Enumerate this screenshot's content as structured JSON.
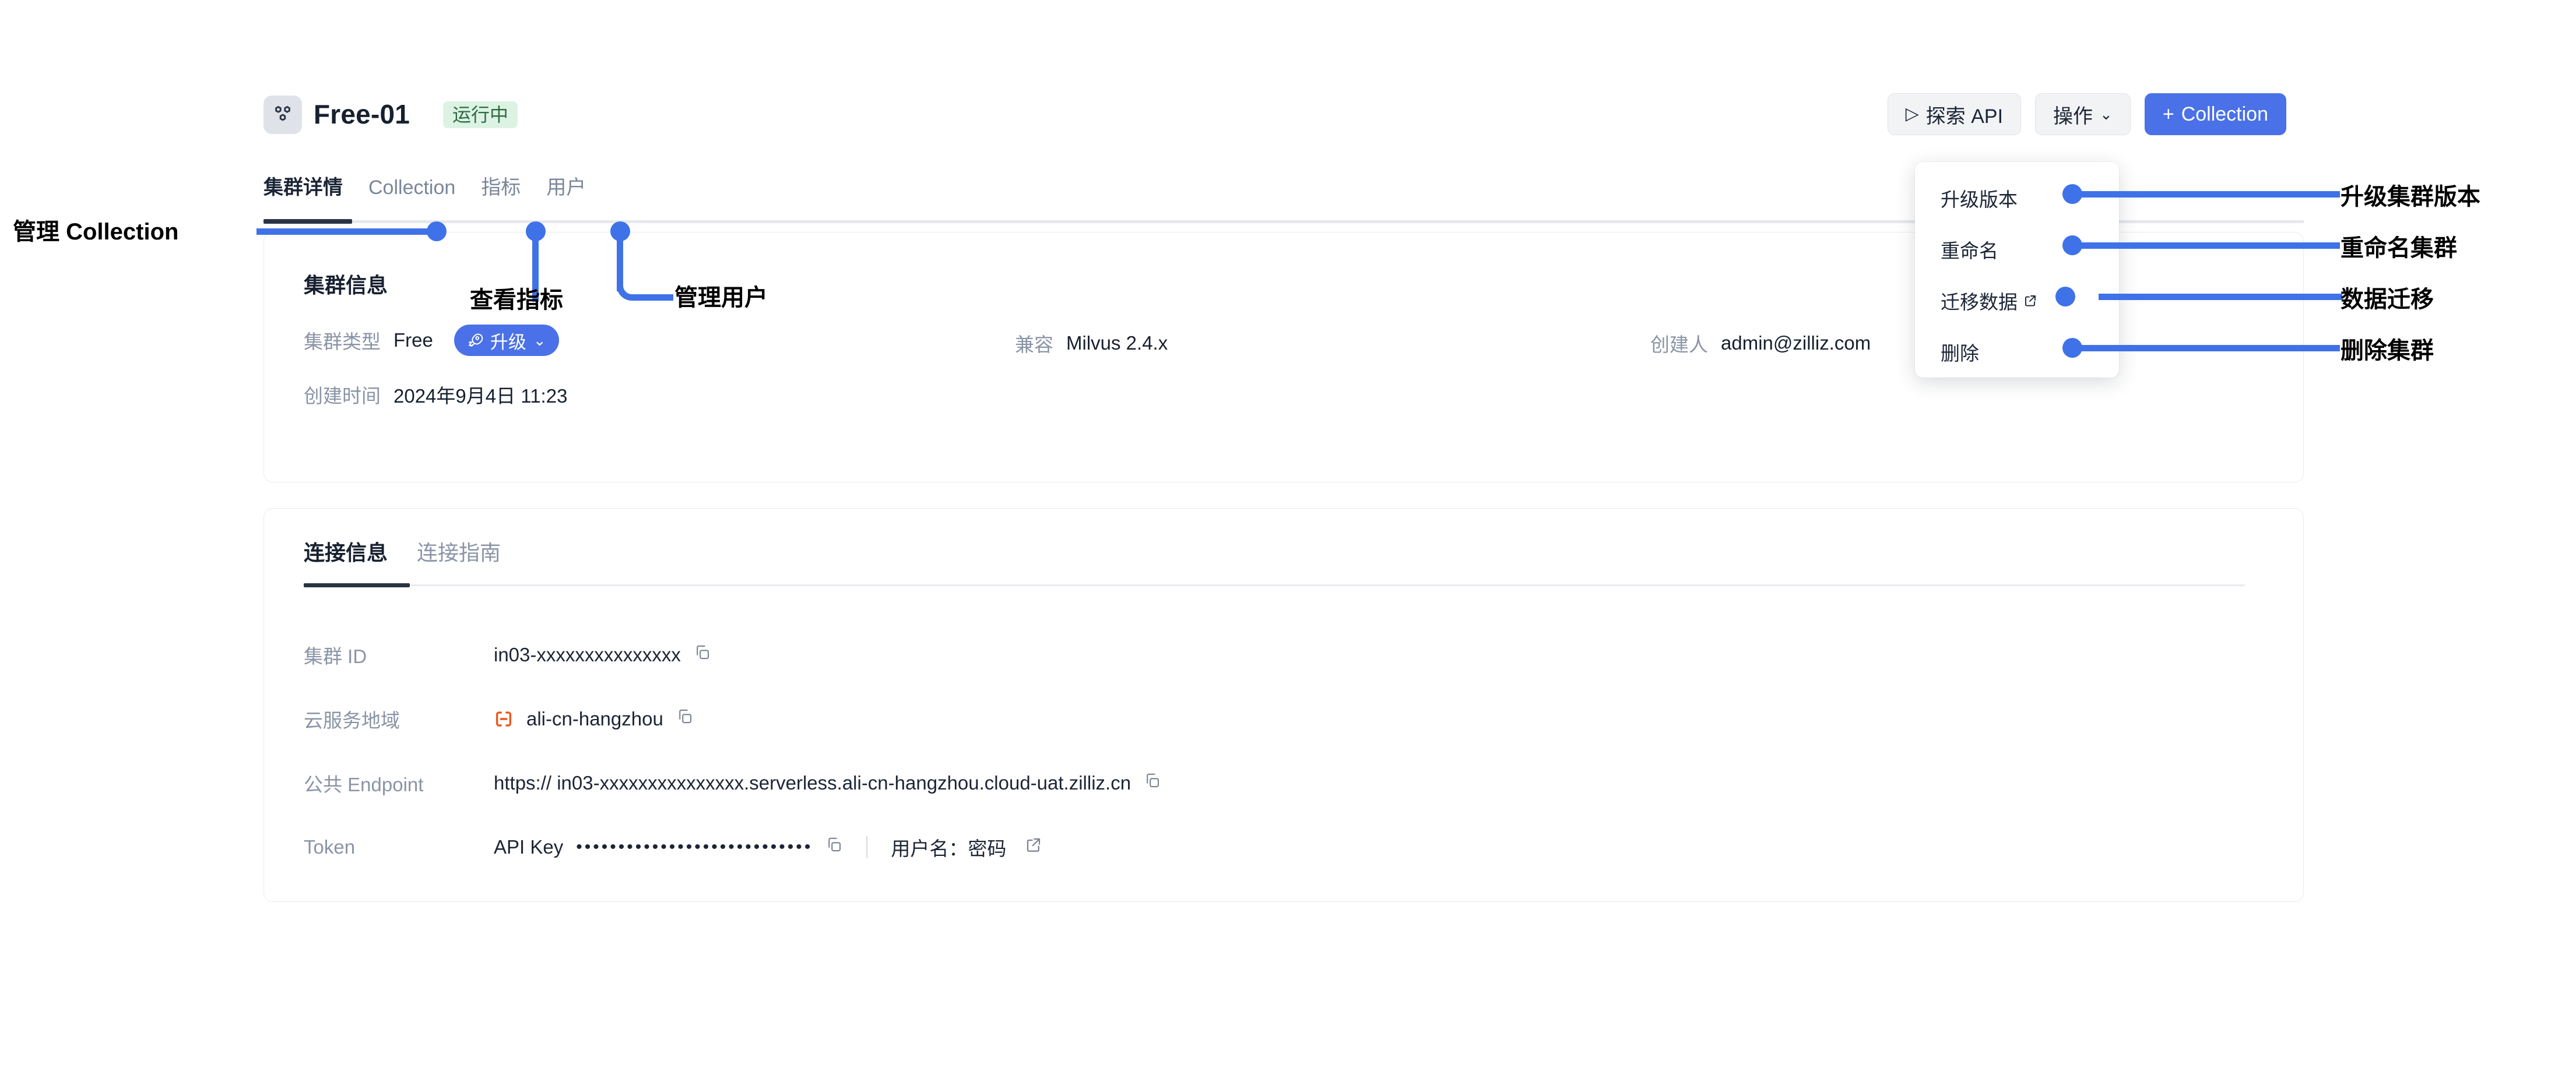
{
  "header": {
    "cluster_icon": "cluster-hexagons-icon",
    "title": "Free-01",
    "status": "运行中",
    "explore_api_label": "探索 API",
    "explore_api_icon": "play-icon",
    "actions_label": "操作",
    "actions_chevron": "chevron-down-icon",
    "create_collection_label": "Collection",
    "create_collection_plus": "+"
  },
  "tabs": [
    {
      "label": "集群详情",
      "active": true
    },
    {
      "label": "Collection",
      "active": false
    },
    {
      "label": "指标",
      "active": false
    },
    {
      "label": "用户",
      "active": false
    }
  ],
  "cluster_info": {
    "title": "集群信息",
    "rows": [
      {
        "label": "集群类型",
        "value": "Free",
        "chip": {
          "icon": "rocket-icon",
          "label": "升级",
          "chevron": "chevron-down-icon"
        }
      },
      {
        "label": "兼容",
        "value": "Milvus 2.4.x"
      },
      {
        "label": "创建人",
        "value": "admin@zilliz.com"
      },
      {
        "label": "创建时间",
        "value": "2024年9月4日 11:23"
      }
    ]
  },
  "connection": {
    "tabs": [
      {
        "label": "连接信息",
        "active": true
      },
      {
        "label": "连接指南",
        "active": false
      }
    ],
    "rows": [
      {
        "label": "集群 ID",
        "value": "in03-xxxxxxxxxxxxxxx",
        "copy_icon": "copy-icon"
      },
      {
        "label": "云服务地域",
        "region_icon": "alibaba-cloud-icon",
        "value": "ali-cn-hangzhou",
        "copy_icon": "copy-icon"
      },
      {
        "label": "公共 Endpoint",
        "value": "https:// in03-xxxxxxxxxxxxxxx.serverless.ali-cn-hangzhou.cloud-uat.zilliz.cn",
        "copy_icon": "copy-icon"
      },
      {
        "label": "Token",
        "value": "API Key",
        "masked": "••••••••••••••••••••••••••••",
        "copy_icon": "copy-icon",
        "alt_label": "用户名：密码",
        "ext_icon": "external-link-icon"
      }
    ]
  },
  "dropdown": {
    "items": [
      {
        "label": "升级版本",
        "ext": false
      },
      {
        "label": "重命名",
        "ext": false
      },
      {
        "label": "迁移数据",
        "ext": true,
        "ext_icon": "external-link-icon"
      },
      {
        "label": "删除",
        "ext": false
      }
    ]
  },
  "annotations": {
    "accent_color": "#3f72e8",
    "left": [
      {
        "text": "管理 Collection"
      },
      {
        "text": "查看指标"
      },
      {
        "text": "管理用户"
      }
    ],
    "right": [
      {
        "text": "升级集群版本"
      },
      {
        "text": "重命名集群"
      },
      {
        "text": "数据迁移"
      },
      {
        "text": "删除集群"
      }
    ]
  },
  "colors": {
    "primary": "#4a71e8",
    "annotation": "#3f72e8",
    "status_bg": "#dcf3e3",
    "status_fg": "#2e6b45",
    "text": "#17202f",
    "muted": "#8a94a6",
    "region_icon": "#e8591e"
  }
}
